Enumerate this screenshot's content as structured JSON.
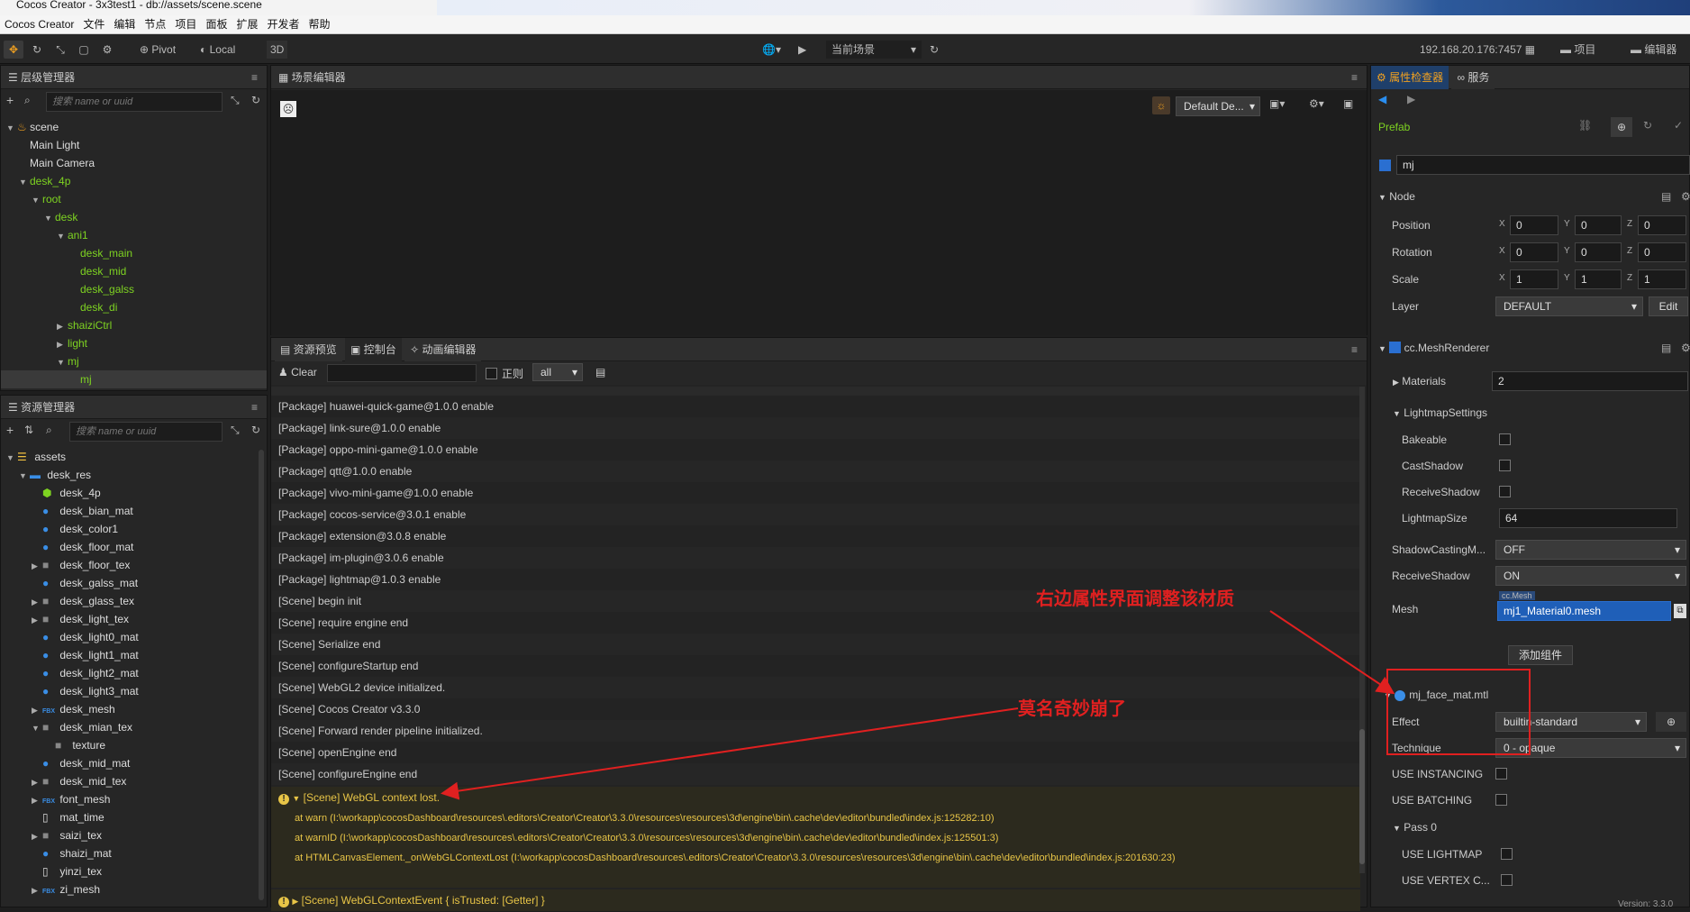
{
  "window": {
    "title": "Cocos Creator - 3x3test1 - db://assets/scene.scene"
  },
  "menubar": [
    "Cocos Creator",
    "文件",
    "编辑",
    "节点",
    "项目",
    "面板",
    "扩展",
    "开发者",
    "帮助"
  ],
  "toolbar": {
    "pivot": "Pivot",
    "local": "Local",
    "mode3d": "3D",
    "scene_select": "当前场景",
    "ip": "192.168.20.176:7457",
    "project": "项目",
    "editor": "编辑器"
  },
  "hierarchy": {
    "title": "层级管理器",
    "search_placeholder": "搜索 name or uuid",
    "nodes": [
      {
        "label": "scene",
        "depth": 0,
        "arrow": "▼",
        "green": false,
        "icon": "🔥"
      },
      {
        "label": "Main Light",
        "depth": 1,
        "arrow": "",
        "green": false
      },
      {
        "label": "Main Camera",
        "depth": 1,
        "arrow": "",
        "green": false
      },
      {
        "label": "desk_4p",
        "depth": 1,
        "arrow": "▼",
        "green": true
      },
      {
        "label": "root",
        "depth": 2,
        "arrow": "▼",
        "green": true
      },
      {
        "label": "desk",
        "depth": 3,
        "arrow": "▼",
        "green": true
      },
      {
        "label": "ani1",
        "depth": 4,
        "arrow": "▼",
        "green": true
      },
      {
        "label": "desk_main",
        "depth": 5,
        "arrow": "",
        "green": true
      },
      {
        "label": "desk_mid",
        "depth": 5,
        "arrow": "",
        "green": true
      },
      {
        "label": "desk_galss",
        "depth": 5,
        "arrow": "",
        "green": true
      },
      {
        "label": "desk_di",
        "depth": 5,
        "arrow": "",
        "green": true
      },
      {
        "label": "shaiziCtrl",
        "depth": 4,
        "arrow": "▶",
        "green": true
      },
      {
        "label": "light",
        "depth": 4,
        "arrow": "▶",
        "green": true
      },
      {
        "label": "mj",
        "depth": 4,
        "arrow": "▼",
        "green": true
      },
      {
        "label": "mj",
        "depth": 5,
        "arrow": "",
        "green": true,
        "selected": true
      }
    ]
  },
  "assets": {
    "title": "资源管理器",
    "search_placeholder": "搜索 name or uuid",
    "items": [
      {
        "label": "assets",
        "depth": 0,
        "arrow": "▼",
        "icon": "db"
      },
      {
        "label": "desk_res",
        "depth": 1,
        "arrow": "▼",
        "icon": "folder"
      },
      {
        "label": "desk_4p",
        "depth": 2,
        "arrow": "",
        "icon": "prefab"
      },
      {
        "label": "desk_bian_mat",
        "depth": 2,
        "arrow": "",
        "icon": "mat"
      },
      {
        "label": "desk_color1",
        "depth": 2,
        "arrow": "",
        "icon": "mat"
      },
      {
        "label": "desk_floor_mat",
        "depth": 2,
        "arrow": "",
        "icon": "mat"
      },
      {
        "label": "desk_floor_tex",
        "depth": 2,
        "arrow": "▶",
        "icon": "tex"
      },
      {
        "label": "desk_galss_mat",
        "depth": 2,
        "arrow": "",
        "icon": "mat"
      },
      {
        "label": "desk_glass_tex",
        "depth": 2,
        "arrow": "▶",
        "icon": "tex"
      },
      {
        "label": "desk_light_tex",
        "depth": 2,
        "arrow": "▶",
        "icon": "tex"
      },
      {
        "label": "desk_light0_mat",
        "depth": 2,
        "arrow": "",
        "icon": "mat"
      },
      {
        "label": "desk_light1_mat",
        "depth": 2,
        "arrow": "",
        "icon": "mat"
      },
      {
        "label": "desk_light2_mat",
        "depth": 2,
        "arrow": "",
        "icon": "mat"
      },
      {
        "label": "desk_light3_mat",
        "depth": 2,
        "arrow": "",
        "icon": "mat"
      },
      {
        "label": "desk_mesh",
        "depth": 2,
        "arrow": "▶",
        "icon": "fbx"
      },
      {
        "label": "desk_mian_tex",
        "depth": 2,
        "arrow": "▼",
        "icon": "tex"
      },
      {
        "label": "texture",
        "depth": 3,
        "arrow": "",
        "icon": "tex"
      },
      {
        "label": "desk_mid_mat",
        "depth": 2,
        "arrow": "",
        "icon": "mat"
      },
      {
        "label": "desk_mid_tex",
        "depth": 2,
        "arrow": "▶",
        "icon": "tex"
      },
      {
        "label": "font_mesh",
        "depth": 2,
        "arrow": "▶",
        "icon": "fbx"
      },
      {
        "label": "mat_time",
        "depth": 2,
        "arrow": "",
        "icon": "file"
      },
      {
        "label": "saizi_tex",
        "depth": 2,
        "arrow": "▶",
        "icon": "tex"
      },
      {
        "label": "shaizi_mat",
        "depth": 2,
        "arrow": "",
        "icon": "mat"
      },
      {
        "label": "yinzi_tex",
        "depth": 2,
        "arrow": "",
        "icon": "file"
      },
      {
        "label": "zi_mesh",
        "depth": 2,
        "arrow": "▶",
        "icon": "fbx"
      }
    ]
  },
  "scene_editor": {
    "title": "场景编辑器",
    "camera": "Default De..."
  },
  "bottom_tabs": [
    "资源预览",
    "控制台",
    "动画编辑器"
  ],
  "console": {
    "clear": "Clear",
    "regex": "正则",
    "filter": "all",
    "lines": [
      {
        "text": "[Package] huawei-quick-game@1.0.0 enable",
        "type": "log"
      },
      {
        "text": "[Package] link-sure@1.0.0 enable",
        "type": "log"
      },
      {
        "text": "[Package] oppo-mini-game@1.0.0 enable",
        "type": "log"
      },
      {
        "text": "[Package] qtt@1.0.0 enable",
        "type": "log"
      },
      {
        "text": "[Package] vivo-mini-game@1.0.0 enable",
        "type": "log"
      },
      {
        "text": "[Package] cocos-service@3.0.1 enable",
        "type": "log"
      },
      {
        "text": "[Package] extension@3.0.8 enable",
        "type": "log"
      },
      {
        "text": "[Package] im-plugin@3.0.6 enable",
        "type": "log"
      },
      {
        "text": "[Package] lightmap@1.0.3 enable",
        "type": "log"
      },
      {
        "text": "[Scene] begin init",
        "type": "log"
      },
      {
        "text": "[Scene] require engine end",
        "type": "log"
      },
      {
        "text": "[Scene] Serialize end",
        "type": "log"
      },
      {
        "text": "[Scene] configureStartup end",
        "type": "log"
      },
      {
        "text": "[Scene] WebGL2 device initialized.",
        "type": "log"
      },
      {
        "text": "[Scene] Cocos Creator v3.3.0",
        "type": "log"
      },
      {
        "text": "[Scene] Forward render pipeline initialized.",
        "type": "log"
      },
      {
        "text": "[Scene] openEngine end",
        "type": "log"
      },
      {
        "text": "[Scene] configureEngine end",
        "type": "log"
      }
    ],
    "warn1": "[Scene] WebGL context lost.",
    "stack": [
      "at warn (I:\\workapp\\cocosDashboard\\resources\\.editors\\Creator\\Creator\\3.3.0\\resources\\resources\\3d\\engine\\bin\\.cache\\dev\\editor\\bundled\\index.js:125282:10)",
      "at warnID (I:\\workapp\\cocosDashboard\\resources\\.editors\\Creator\\Creator\\3.3.0\\resources\\resources\\3d\\engine\\bin\\.cache\\dev\\editor\\bundled\\index.js:125501:3)",
      "at HTMLCanvasElement._onWebGLContextLost (I:\\workapp\\cocosDashboard\\resources\\.editors\\Creator\\Creator\\3.3.0\\resources\\resources\\3d\\engine\\bin\\.cache\\dev\\editor\\bundled\\index.js:201630:23)"
    ],
    "warn2": "[Scene] WebGLContextEvent { isTrusted: [Getter] }"
  },
  "inspector": {
    "tab1": "属性检查器",
    "tab2": "服务",
    "prefab": "Prefab",
    "node_name": "mj",
    "node_section": "Node",
    "position_label": "Position",
    "position": [
      "0",
      "0",
      "0"
    ],
    "rotation_label": "Rotation",
    "rotation": [
      "0",
      "0",
      "0"
    ],
    "scale_label": "Scale",
    "scale": [
      "1",
      "1",
      "1"
    ],
    "layer_label": "Layer",
    "layer": "DEFAULT",
    "edit": "Edit",
    "mesh_renderer": "cc.MeshRenderer",
    "materials_label": "Materials",
    "materials": "2",
    "lightmap_settings": "LightmapSettings",
    "bakeable": "Bakeable",
    "castshadow": "CastShadow",
    "receiveshadow_lm": "ReceiveShadow",
    "lightmapsize_label": "LightmapSize",
    "lightmapsize": "64",
    "shadowcasting_label": "ShadowCastingM...",
    "shadowcasting": "OFF",
    "receiveshadow_label": "ReceiveShadow",
    "receiveshadow": "ON",
    "mesh_label": "Mesh",
    "mesh_type": "cc.Mesh",
    "mesh": "mj1_Material0.mesh",
    "add_component": "添加组件",
    "material_name": "mj_face_mat.mtl",
    "effect_label": "Effect",
    "effect": "builtin-standard",
    "technique_label": "Technique",
    "technique": "0 - opaque",
    "use_instancing": "USE INSTANCING",
    "use_batching": "USE BATCHING",
    "pass0": "Pass 0",
    "use_lightmap": "USE LIGHTMAP",
    "use_vertex": "USE VERTEX C...",
    "version": "Version: 3.3.0"
  },
  "annotations": {
    "right": "右边属性界面调整该材质",
    "crash": "莫名奇妙崩了"
  },
  "colors": {
    "accent": "#2a6fd1",
    "green": "#7ed321",
    "warn": "#e8c547",
    "annotation": "#e02020"
  }
}
